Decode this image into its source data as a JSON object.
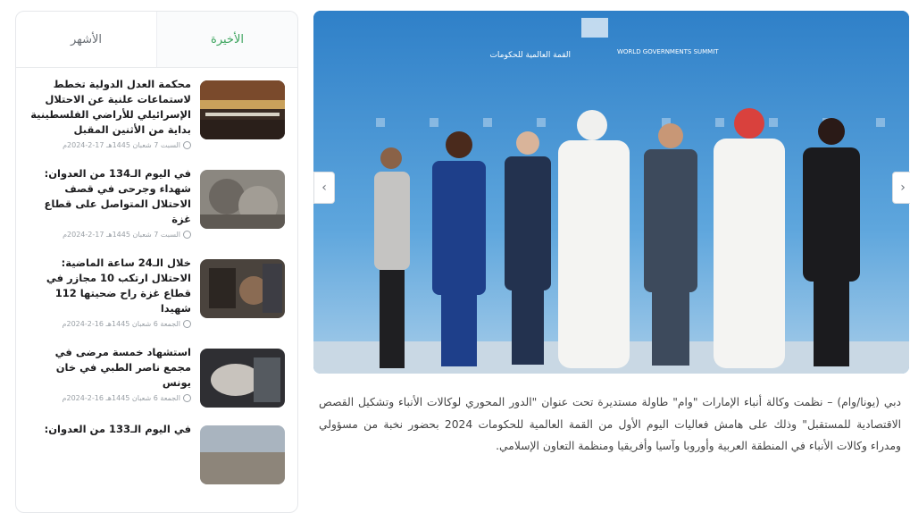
{
  "tabs": {
    "latest": "الأخيرة",
    "popular": "الأشهر"
  },
  "sidebar": {
    "items": [
      {
        "title": "محكمة العدل الدولية تخطط لاستماعات علنية عن الاحتلال الإسرائيلي للأراضي الفلسطينية بداية من الأثنين المقبل",
        "date": "السبت 7 شعبان 1445هـ 17-2-2024م"
      },
      {
        "title": "في اليوم الـ134 من العدوان: شهداء وجرحى في قصف الاحتلال المتواصل على قطاع غزة",
        "date": "السبت 7 شعبان 1445هـ 17-2-2024م"
      },
      {
        "title": "خلال الـ24 ساعة الماضية: الاحتلال ارتكب 10 مجازر في قطاع غزة راح ضحيتها 112 شهيدا",
        "date": "الجمعة 6 شعبان 1445هـ 16-2-2024م"
      },
      {
        "title": "استشهاد خمسة مرضى في مجمع ناصر الطبي في خان يونس",
        "date": "الجمعة 6 شعبان 1445هـ 16-2-2024م"
      },
      {
        "title": "في اليوم الـ133 من العدوان:",
        "date": ""
      }
    ]
  },
  "hero": {
    "banner_en": "WORLD GOVERNMENTS SUMMIT",
    "banner_ar": "القمة العالمية للحكومات"
  },
  "article": {
    "p1": "دبي (يونا/وام) – نظمت وكالة أنباء الإمارات \"وام\" طاولة مستديرة تحت عنوان \"الدور المحوري لوكالات الأنباء وتشكيل القصص الاقتصادية للمستقبل\" وذلك على هامش فعاليات اليوم الأول من القمة العالمية للحكومات 2024 بحضور نخبة من مسؤولي ومدراء وكالات الأنباء في المنطقة العربية وأوروبا وآسيا وأفريقيا ومنظمة التعاون الإسلامي."
  },
  "icons": {
    "prev": "‹",
    "next": "›"
  },
  "colors": {
    "accent": "#3aa35c",
    "hero_bg": "#3f8fd0"
  }
}
